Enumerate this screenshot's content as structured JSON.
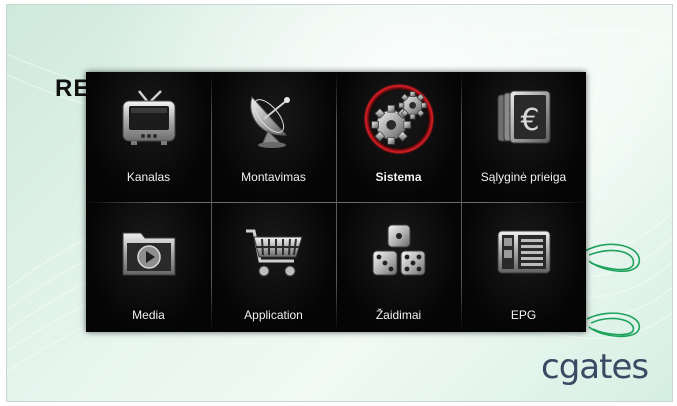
{
  "screen": {
    "title": "RE",
    "brand": "cgates"
  },
  "menu": {
    "selected_index": 2,
    "items": [
      {
        "label": "Kanalas",
        "icon": "tv-icon"
      },
      {
        "label": "Montavimas",
        "icon": "satellite-dish-icon"
      },
      {
        "label": "Sistema",
        "icon": "gears-icon"
      },
      {
        "label": "Sąlyginė prieiga",
        "icon": "euro-icon"
      },
      {
        "label": "Media",
        "icon": "media-folder-icon"
      },
      {
        "label": "Application",
        "icon": "shopping-cart-icon"
      },
      {
        "label": "Žaidimai",
        "icon": "dice-icon"
      },
      {
        "label": "EPG",
        "icon": "epg-guide-icon"
      }
    ]
  },
  "colors": {
    "menu_bg": "#060606",
    "selected_ring": "#c4161c",
    "brand": "#3b4a63",
    "swoosh": "#1fa35c"
  }
}
